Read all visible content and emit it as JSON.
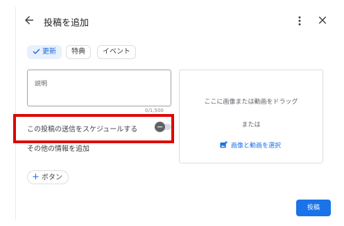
{
  "header": {
    "title": "投稿を追加",
    "back_icon": "arrow-left-icon",
    "more_icon": "more-vert-icon",
    "close_icon": "close-icon"
  },
  "chips": [
    {
      "label": "更新",
      "selected": true
    },
    {
      "label": "特典",
      "selected": false
    },
    {
      "label": "イベント",
      "selected": false
    }
  ],
  "description": {
    "label": "説明",
    "counter": "0/1,500"
  },
  "schedule": {
    "label": "この投稿の送信をスケジュールする",
    "enabled": false
  },
  "more_info": {
    "label": "その他の情報を追加"
  },
  "add_button": {
    "label": "ボタン"
  },
  "media": {
    "drag_text": "ここに画像または動画をドラッグ",
    "or_text": "または",
    "select_label": "画像と動画を選択",
    "select_icon": "add-photo-icon"
  },
  "post_button": {
    "label": "投稿"
  },
  "colors": {
    "accent": "#1a73e8",
    "highlight": "#e00000",
    "chip_selected_bg": "#e8f0fe"
  }
}
